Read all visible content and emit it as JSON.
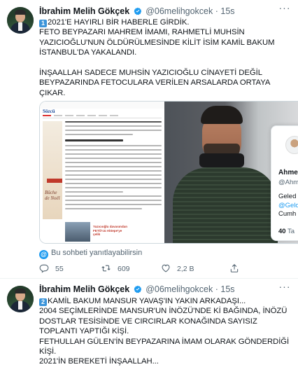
{
  "tweets": [
    {
      "author": {
        "name": "İbrahim Melih Gökçek",
        "handle": "@06melihgokcek",
        "dot": "·",
        "time": "15s"
      },
      "badge": "1",
      "text": "2021'E HAYIRLI BİR HABERLE GİRDİK.\nFETO BEYPAZARI MAHREM İMAMI, RAHMETLİ MUHSİN YAZICIOĞLU'NUN ÖLDÜRÜLMESİNDE KİLİT İSİM KAMİL BAKUM İSTANBUL'DA YAKALANDI.\n\nİNŞAALLAH SADECE MUHSİN YAZICIOĞLU CİNAYETİ DEĞİL BEYPAZARINDA FETOCULARA VERİLEN ARSALARDA ORTAYA ÇIKAR.",
      "media": {
        "article_logo": "Sözcü",
        "ad_text": "Bûche\nde Noël",
        "thumb_caption": "Yazıcıoğlu davasından\nFETÖ'cü Aktepe'ye\nçelik"
      },
      "hover_card": {
        "name": "Ahme",
        "handle": "@Ahm",
        "bio_line1": "Geled",
        "bio_link": "@Gelo",
        "bio_line3": "Cumh",
        "stat_value": "40",
        "stat_label": "Ta"
      },
      "conversation_label": "Bu sohbeti yanıtlayabilirsin",
      "actions": {
        "replies": "55",
        "retweets": "609",
        "likes": "2,2 B"
      }
    },
    {
      "author": {
        "name": "İbrahim Melih Gökçek",
        "handle": "@06melihgokcek",
        "dot": "·",
        "time": "15s"
      },
      "badge": "2",
      "text": "KAMİL BAKUM MANSUR YAVAŞ'IN YAKIN ARKADAŞI...\n2004 SEÇİMLERİNDE MANSUR'UN İNÖZÜ'NDE Kİ BAĞINDA, İNÖZÜ DOSTLAR TESİSİNDE VE CIRCIRLAR KONAĞINDA SAYISIZ TOPLANTI YAPTIĞI KİŞİ.\nFETHULLAH GÜLEN'İN BEYPAZARINA İMAM OLARAK GÖNDERDİĞİ KİŞİ.\n2021'İN BEREKETİ İNŞAALLAH..."
    }
  ],
  "colors": {
    "accent": "#1d9bf0",
    "text": "#0f1419",
    "muted": "#536471",
    "badge": "#3b94d9"
  },
  "icons": [
    "verified-icon",
    "more-icon",
    "reply-icon",
    "retweet-icon",
    "like-icon",
    "share-icon",
    "mention-icon"
  ]
}
